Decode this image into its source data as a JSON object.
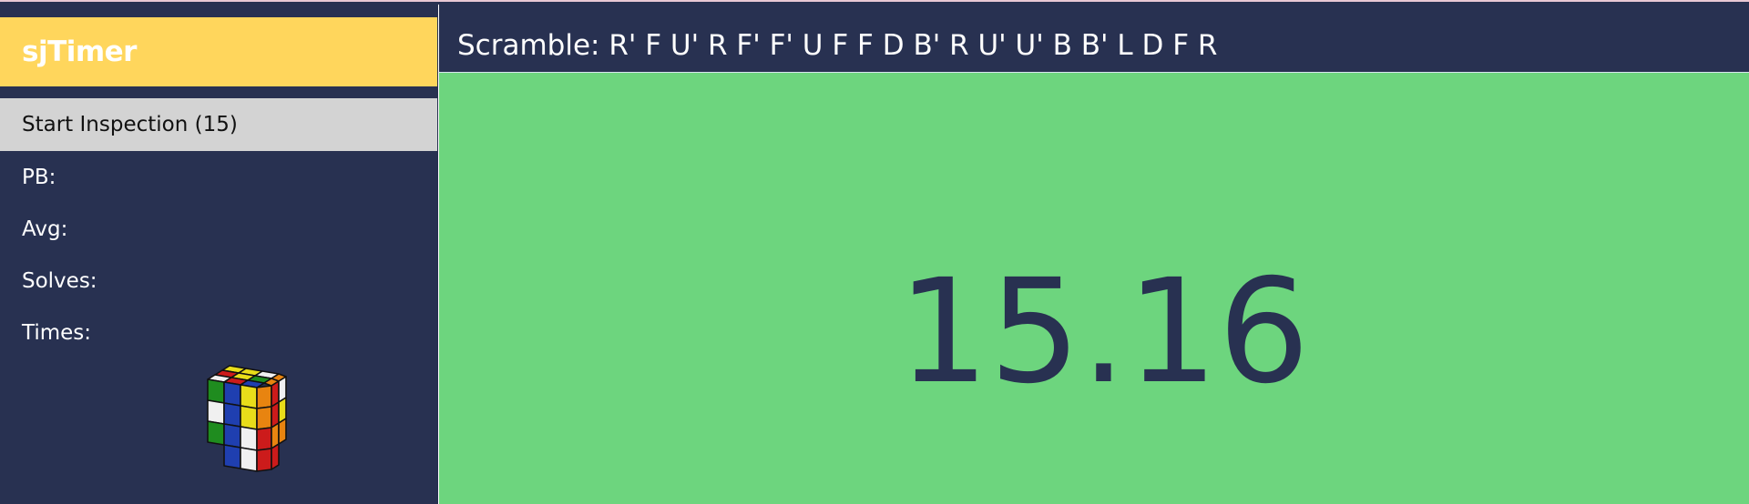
{
  "app": {
    "title": "sjTimer",
    "accent_color": "#ffd65c",
    "background_color": "#283151",
    "timer_bg_color": "#6dd57e"
  },
  "sidebar": {
    "inspection_button_label": "Start Inspection (15)",
    "stats": {
      "pb_label": "PB:",
      "avg_label": "Avg:",
      "solves_label": "Solves:",
      "times_label": "Times:"
    },
    "cube_icon": "rubiks-cube-icon"
  },
  "header": {
    "scramble_label": "Scramble:",
    "scramble": "R' F U' R F' F' U F F D B' R U' U' B B' L D F R"
  },
  "timer": {
    "value": "15.16"
  }
}
